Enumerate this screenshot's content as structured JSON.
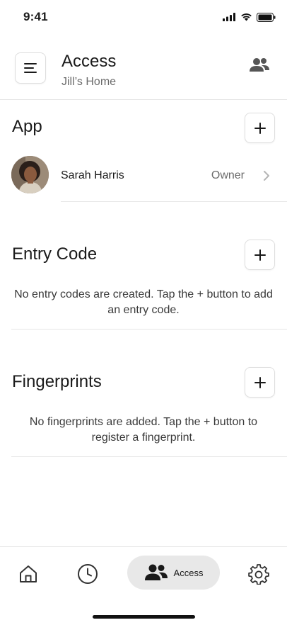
{
  "status_bar": {
    "time": "9:41",
    "icons": [
      "signal-icon",
      "wifi-icon",
      "battery-icon"
    ]
  },
  "header": {
    "title": "Access",
    "subtitle": "Jill’s Home",
    "menu_icon": "menu-icon",
    "people_icon": "people-icon"
  },
  "sections": {
    "app": {
      "title": "App",
      "members": [
        {
          "name": "Sarah Harris",
          "role": "Owner"
        }
      ]
    },
    "entry_code": {
      "title": "Entry Code",
      "empty_message": "No entry codes are created. Tap the + button to add an entry code."
    },
    "fingerprints": {
      "title": "Fingerprints",
      "empty_message": "No fingerprints are added. Tap the + button to register a fingerprint."
    }
  },
  "tab_bar": {
    "tabs": [
      {
        "icon": "home-icon"
      },
      {
        "icon": "clock-icon"
      },
      {
        "icon": "people-icon",
        "label": "Access",
        "active": true
      },
      {
        "icon": "gear-icon"
      }
    ]
  },
  "colors": {
    "text": "#1a1a1a",
    "secondary": "#6b6b6b",
    "divider": "#e6e6e6",
    "active_tab_bg": "#e8e8e8"
  }
}
